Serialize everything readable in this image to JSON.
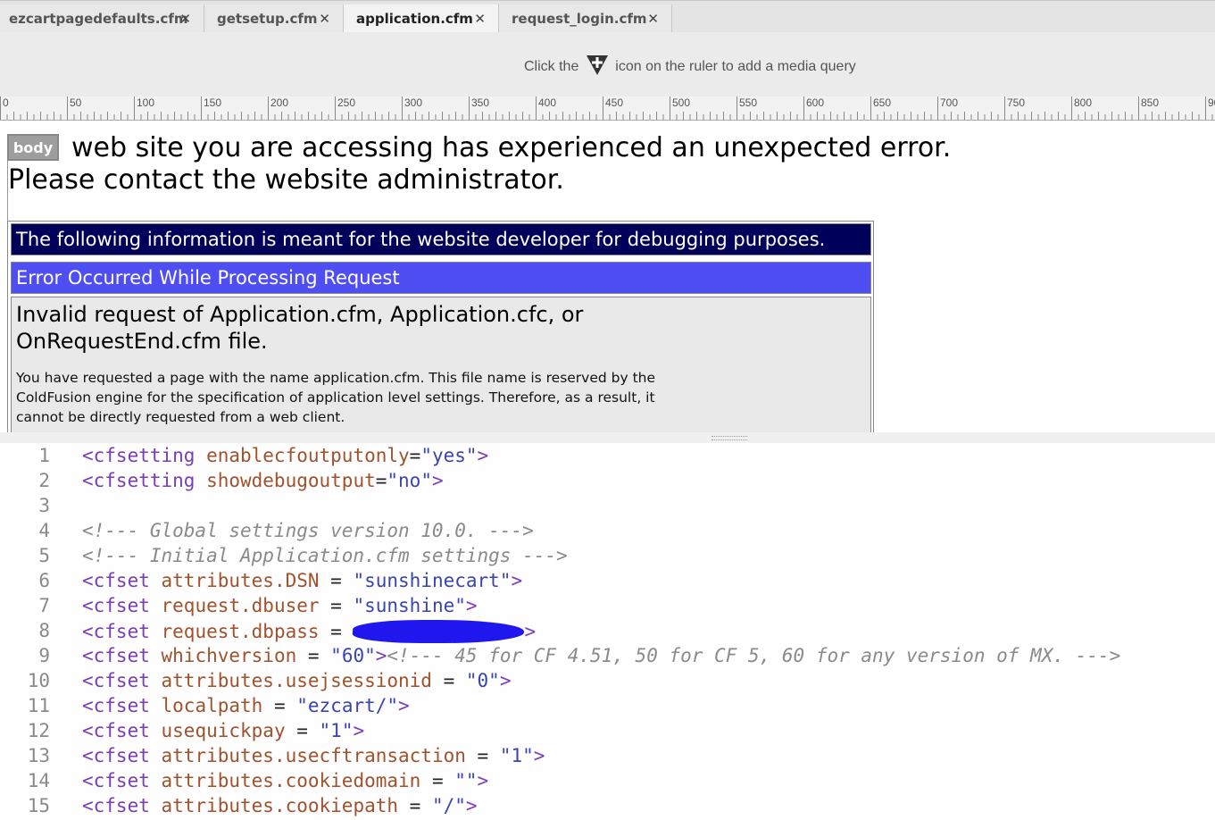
{
  "tabs": [
    {
      "label": "ezcartpagedefaults.cfm",
      "close": "✕",
      "active": false
    },
    {
      "label": "getsetup.cfm",
      "close": "✕",
      "active": false
    },
    {
      "label": "application.cfm",
      "close": "✕",
      "active": true
    },
    {
      "label": "request_login.cfm",
      "close": "✕",
      "active": false
    }
  ],
  "media_query_hint": {
    "before": "Click the",
    "icon": "add-media-query-icon",
    "after": "icon on the ruler to add a media query"
  },
  "ruler": {
    "labels": [
      "0",
      "50",
      "100",
      "150",
      "200",
      "250",
      "300",
      "350",
      "400",
      "450",
      "500",
      "550",
      "600",
      "650",
      "700",
      "750",
      "800",
      "850",
      "90"
    ]
  },
  "live_view": {
    "body_tag": "body",
    "error_line1": "web site you are accessing has experienced an unexpected error.",
    "error_line2": "Please contact the website administrator.",
    "debug_notice": "The following information is meant for the website developer for debugging purposes.",
    "error_heading": "Error Occurred While Processing Request",
    "error_title": "Invalid request of Application.cfm, Application.cfc, or OnRequestEnd.cfm file.",
    "error_description": "You have requested a page with the name application.cfm. This file name is reserved by the ColdFusion engine for the specification of application level settings. Therefore, as a result, it cannot be directly requested from a web client."
  },
  "colors": {
    "debug_band": "#00005a",
    "error_band": "#4e4ef2",
    "tag": "#7a3db8",
    "attr": "#a0522d",
    "string": "#3a44b0",
    "comment": "#8a8a8a",
    "redaction": "#1f17ee"
  },
  "code_lines": [
    {
      "n": "1",
      "tokens": [
        [
          "tag",
          "<cfsetting "
        ],
        [
          "attr",
          "enablecfoutputonly"
        ],
        [
          "op",
          "="
        ],
        [
          "str",
          "\"yes\""
        ],
        [
          "tag",
          ">"
        ]
      ]
    },
    {
      "n": "2",
      "tokens": [
        [
          "tag",
          "<cfsetting "
        ],
        [
          "attr",
          "showdebugoutput"
        ],
        [
          "op",
          "="
        ],
        [
          "str",
          "\"no\""
        ],
        [
          "tag",
          ">"
        ]
      ]
    },
    {
      "n": "3",
      "tokens": []
    },
    {
      "n": "4",
      "tokens": [
        [
          "com",
          "<!--- Global settings version 10.0. --->"
        ]
      ]
    },
    {
      "n": "5",
      "tokens": [
        [
          "com",
          "<!--- Initial Application.cfm settings --->"
        ]
      ]
    },
    {
      "n": "6",
      "tokens": [
        [
          "tag",
          "<cfset "
        ],
        [
          "attr",
          "attributes.DSN"
        ],
        [
          "op",
          " = "
        ],
        [
          "str",
          "\"sunshinecart\""
        ],
        [
          "tag",
          ">"
        ]
      ]
    },
    {
      "n": "7",
      "tokens": [
        [
          "tag",
          "<cfset "
        ],
        [
          "attr",
          "request.dbuser"
        ],
        [
          "op",
          " = "
        ],
        [
          "str",
          "\"sunshine\""
        ],
        [
          "tag",
          ">"
        ]
      ]
    },
    {
      "n": "8",
      "tokens": [
        [
          "tag",
          "<cfset "
        ],
        [
          "attr",
          "request.dbpass"
        ],
        [
          "op",
          " = "
        ],
        [
          "redact",
          ""
        ],
        [
          "tag",
          ">"
        ]
      ]
    },
    {
      "n": "9",
      "tokens": [
        [
          "tag",
          "<cfset "
        ],
        [
          "attr",
          "whichversion"
        ],
        [
          "op",
          " = "
        ],
        [
          "str",
          "\"60\""
        ],
        [
          "tag",
          ">"
        ],
        [
          "com",
          "<!--- 45 for CF 4.51, 50 for CF 5, 60 for any version of MX. --->"
        ]
      ]
    },
    {
      "n": "10",
      "tokens": [
        [
          "tag",
          "<cfset "
        ],
        [
          "attr",
          "attributes.usejsessionid"
        ],
        [
          "op",
          " = "
        ],
        [
          "str",
          "\"0\""
        ],
        [
          "tag",
          ">"
        ]
      ]
    },
    {
      "n": "11",
      "tokens": [
        [
          "tag",
          "<cfset "
        ],
        [
          "attr",
          "localpath"
        ],
        [
          "op",
          " = "
        ],
        [
          "str",
          "\"ezcart/\""
        ],
        [
          "tag",
          ">"
        ]
      ]
    },
    {
      "n": "12",
      "tokens": [
        [
          "tag",
          "<cfset "
        ],
        [
          "attr",
          "usequickpay"
        ],
        [
          "op",
          " = "
        ],
        [
          "str",
          "\"1\""
        ],
        [
          "tag",
          ">"
        ]
      ]
    },
    {
      "n": "13",
      "tokens": [
        [
          "tag",
          "<cfset "
        ],
        [
          "attr",
          "attributes.usecftransaction"
        ],
        [
          "op",
          " = "
        ],
        [
          "str",
          "\"1\""
        ],
        [
          "tag",
          ">"
        ]
      ]
    },
    {
      "n": "14",
      "tokens": [
        [
          "tag",
          "<cfset "
        ],
        [
          "attr",
          "attributes.cookiedomain"
        ],
        [
          "op",
          " = "
        ],
        [
          "str",
          "\"\""
        ],
        [
          "tag",
          ">"
        ]
      ]
    },
    {
      "n": "15",
      "tokens": [
        [
          "tag",
          "<cfset "
        ],
        [
          "attr",
          "attributes.cookiepath"
        ],
        [
          "op",
          " = "
        ],
        [
          "str",
          "\"/\""
        ],
        [
          "tag",
          ">"
        ]
      ]
    }
  ]
}
